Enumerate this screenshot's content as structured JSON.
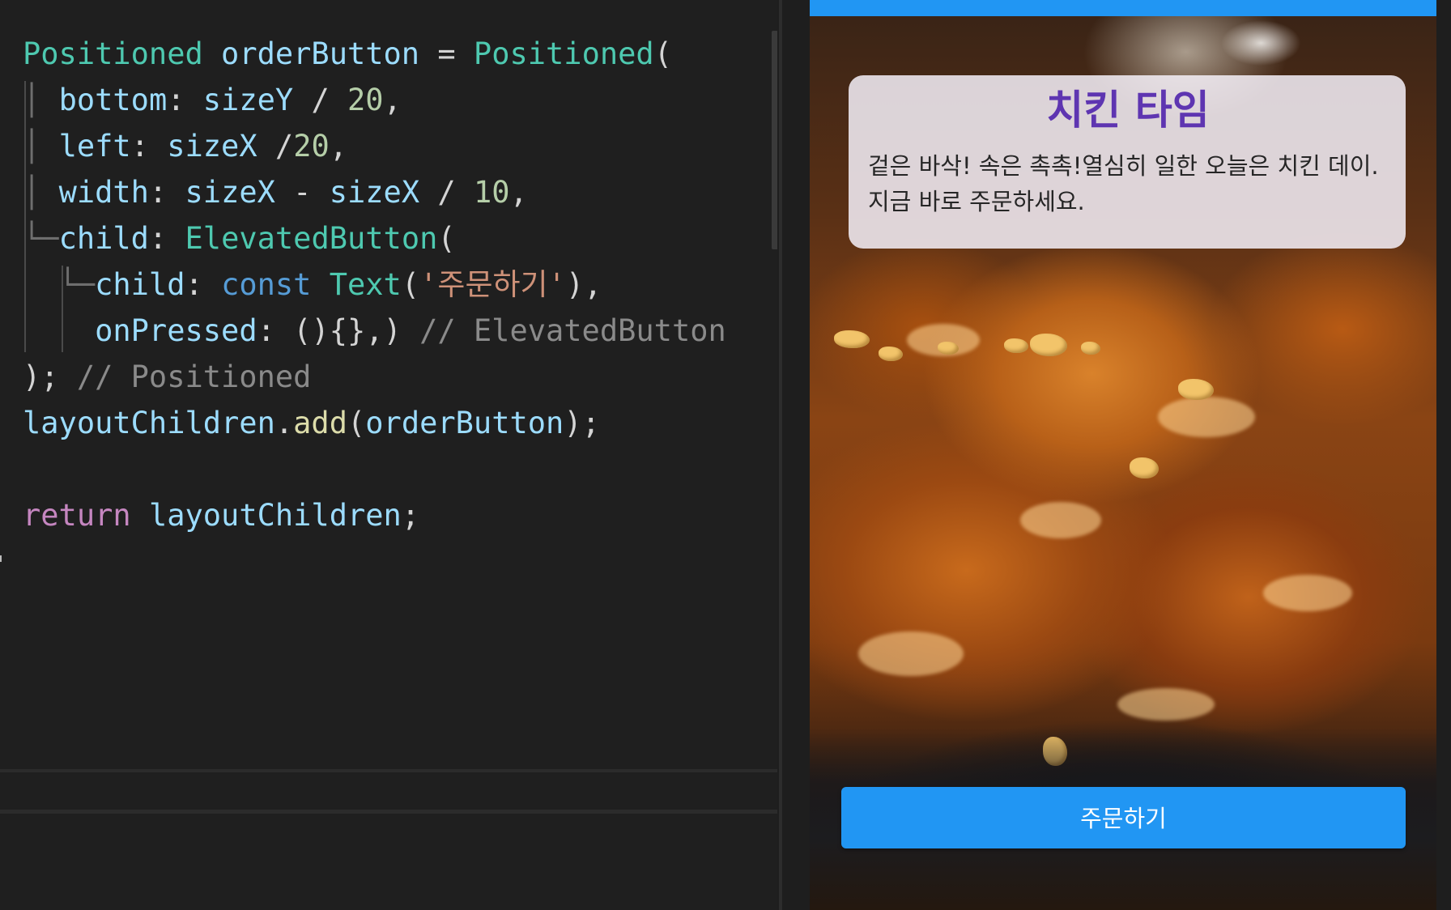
{
  "editor": {
    "lines": [
      [
        {
          "t": "Positioned",
          "c": "class"
        },
        {
          "t": " ",
          "c": "punc"
        },
        {
          "t": "orderButton",
          "c": "var"
        },
        {
          "t": " = ",
          "c": "punc"
        },
        {
          "t": "Positioned",
          "c": "class"
        },
        {
          "t": "(",
          "c": "punc"
        }
      ],
      [
        {
          "t": "│ ",
          "c": "guide"
        },
        {
          "t": "bottom",
          "c": "var"
        },
        {
          "t": ": ",
          "c": "punc"
        },
        {
          "t": "sizeY",
          "c": "var"
        },
        {
          "t": " / ",
          "c": "punc"
        },
        {
          "t": "20",
          "c": "num"
        },
        {
          "t": ",",
          "c": "punc"
        }
      ],
      [
        {
          "t": "│ ",
          "c": "guide"
        },
        {
          "t": "left",
          "c": "var"
        },
        {
          "t": ": ",
          "c": "punc"
        },
        {
          "t": "sizeX",
          "c": "var"
        },
        {
          "t": " /",
          "c": "punc"
        },
        {
          "t": "20",
          "c": "num"
        },
        {
          "t": ",",
          "c": "punc"
        }
      ],
      [
        {
          "t": "│ ",
          "c": "guide"
        },
        {
          "t": "width",
          "c": "var"
        },
        {
          "t": ": ",
          "c": "punc"
        },
        {
          "t": "sizeX",
          "c": "var"
        },
        {
          "t": " - ",
          "c": "punc"
        },
        {
          "t": "sizeX",
          "c": "var"
        },
        {
          "t": " / ",
          "c": "punc"
        },
        {
          "t": "10",
          "c": "num"
        },
        {
          "t": ",",
          "c": "punc"
        }
      ],
      [
        {
          "t": "└─",
          "c": "guide"
        },
        {
          "t": "child",
          "c": "var"
        },
        {
          "t": ": ",
          "c": "punc"
        },
        {
          "t": "ElevatedButton",
          "c": "class"
        },
        {
          "t": "(",
          "c": "punc"
        }
      ],
      [
        {
          "t": "  └─",
          "c": "guide"
        },
        {
          "t": "child",
          "c": "var"
        },
        {
          "t": ": ",
          "c": "punc"
        },
        {
          "t": "const",
          "c": "kw"
        },
        {
          "t": " ",
          "c": "punc"
        },
        {
          "t": "Text",
          "c": "class"
        },
        {
          "t": "(",
          "c": "punc"
        },
        {
          "t": "'주문하기'",
          "c": "str"
        },
        {
          "t": "),",
          "c": "punc"
        }
      ],
      [
        {
          "t": "    ",
          "c": "punc"
        },
        {
          "t": "onPressed",
          "c": "var"
        },
        {
          "t": ": (){},) ",
          "c": "punc"
        },
        {
          "t": "// ElevatedButton",
          "c": "cmt"
        }
      ],
      [
        {
          "t": "); ",
          "c": "punc"
        },
        {
          "t": "// Positioned",
          "c": "cmt"
        }
      ],
      [
        {
          "t": "layoutChildren",
          "c": "var"
        },
        {
          "t": ".",
          "c": "punc"
        },
        {
          "t": "add",
          "c": "fn"
        },
        {
          "t": "(",
          "c": "punc"
        },
        {
          "t": "orderButton",
          "c": "var"
        },
        {
          "t": ");",
          "c": "punc"
        }
      ],
      [],
      [
        {
          "t": "return",
          "c": "ctrl"
        },
        {
          "t": " ",
          "c": "punc"
        },
        {
          "t": "layoutChildren",
          "c": "var"
        },
        {
          "t": ";",
          "c": "punc"
        }
      ]
    ]
  },
  "preview": {
    "card": {
      "title": "치킨 타임",
      "description": "겉은 바삭! 속은 촉촉!열심히 일한 오늘은 치킨 데이.\n지금 바로 주문하세요."
    },
    "order_button_label": "주문하기"
  },
  "colors": {
    "app_bar": "#2196f3",
    "button": "#2196f3",
    "title": "#5e35b1",
    "editor_bg": "#1f1f1f"
  }
}
